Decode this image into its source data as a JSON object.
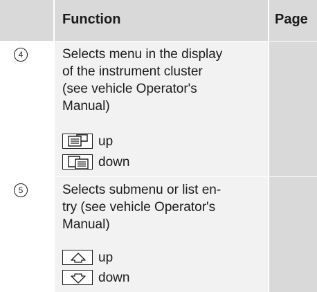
{
  "header": {
    "function": "Function",
    "page": "Page"
  },
  "rows": [
    {
      "number": "4",
      "lines": [
        "Selects menu in the display",
        "of the instrument cluster",
        "(see vehicle Operator's",
        "Manual)"
      ],
      "buttons": [
        {
          "label": "up",
          "icon": "menu-prev-icon"
        },
        {
          "label": "down",
          "icon": "menu-next-icon"
        }
      ]
    },
    {
      "number": "5",
      "lines": [
        "Selects submenu or list en-",
        "try (see vehicle Operator's",
        "Manual)"
      ],
      "buttons": [
        {
          "label": "up",
          "icon": "arrow-up-icon"
        },
        {
          "label": "down",
          "icon": "arrow-down-icon"
        }
      ]
    }
  ]
}
